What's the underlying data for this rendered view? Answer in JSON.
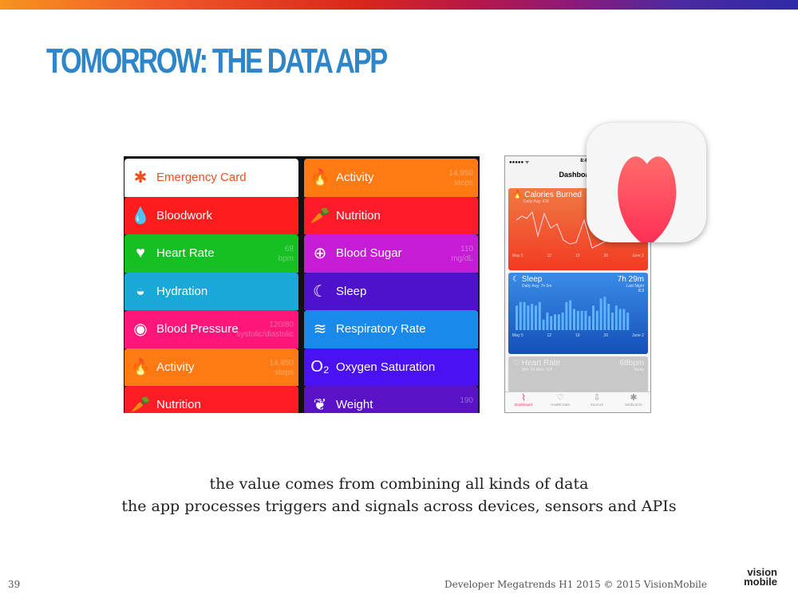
{
  "slide": {
    "title": "TOMORROW: THE DATA APP",
    "caption_line1": "the value comes from combining all kinds of data",
    "caption_line2": "the app processes triggers and signals across devices, sensors and APIs",
    "page_number": "39",
    "footer": "Developer Megatrends H1 2015 © 2015 VisionMobile",
    "logo_text_1": "vision",
    "logo_text_2": "mobile"
  },
  "left_list": [
    {
      "label": "Emergency Card",
      "icon": "asterisk-icon",
      "glyph": "✱",
      "color": "#ffffff",
      "text_color": "#f0501e"
    },
    {
      "label": "Bloodwork",
      "icon": "drop-icon",
      "glyph": "💧",
      "color": "#ff1c1c"
    },
    {
      "label": "Heart Rate",
      "icon": "heart-icon",
      "glyph": "♥",
      "color": "#16c022",
      "value": "68",
      "unit": "bpm"
    },
    {
      "label": "Hydration",
      "icon": "drop-icon",
      "glyph": "◒",
      "color": "#1aa8d6"
    },
    {
      "label": "Blood Pressure",
      "icon": "thermometer-drop-icon",
      "glyph": "◉",
      "color": "#ff167a",
      "value": "120/80",
      "unit": "systolic/diastolic"
    },
    {
      "label": "Activity",
      "icon": "flame-icon",
      "glyph": "🔥",
      "color": "#ff7a12",
      "value": "14,950",
      "unit": "steps"
    },
    {
      "label": "Nutrition",
      "icon": "carrot-icon",
      "glyph": "🥕",
      "color": "#ff1c24"
    }
  ],
  "right_list": [
    {
      "label": "Activity",
      "icon": "flame-icon",
      "glyph": "🔥",
      "color": "#ff7a12",
      "value": "14,950",
      "unit": "steps"
    },
    {
      "label": "Nutrition",
      "icon": "carrot-icon",
      "glyph": "🥕",
      "color": "#ff1c2a"
    },
    {
      "label": "Blood Sugar",
      "icon": "drop-plus-icon",
      "glyph": "⊕",
      "color": "#c61cd6",
      "value": "110",
      "unit": "mg/dL"
    },
    {
      "label": "Sleep",
      "icon": "moon-icon",
      "glyph": "☾",
      "color": "#4e12cc"
    },
    {
      "label": "Respiratory Rate",
      "icon": "wind-icon",
      "glyph": "≋",
      "color": "#1a8aea"
    },
    {
      "label": "Oxygen Saturation",
      "icon": "o2-icon",
      "glyph": "O₂",
      "color": "#4a12f0"
    },
    {
      "label": "Weight",
      "icon": "feather-icon",
      "glyph": "❦",
      "color": "#5a12c6",
      "value": "190"
    }
  ],
  "phone": {
    "status_signal": "●●●●● ᯤ",
    "status_time": "8:41 AM",
    "nav_title": "Dashboard",
    "calories": {
      "title": "Calories Burned",
      "subtitle": "Daily Avg: 425",
      "color": "#f2522c"
    },
    "sleep": {
      "title": "Sleep",
      "subtitle": "Daily Avg: 7h 6m",
      "value": "7h 29m",
      "value_sub": "Last Night",
      "ymax": "8.3",
      "ymin": "0",
      "color": "#1e6fdc"
    },
    "heart": {
      "title": "Heart Rate",
      "subtitle": "Min: 53 Max: 126",
      "value": "68bpm",
      "value_sub": "Today",
      "ymax": "126"
    },
    "x_ticks": [
      "May 5",
      "12",
      "19",
      "26",
      "June 2"
    ],
    "tabs": [
      {
        "label": "Dashboard",
        "active": true
      },
      {
        "label": "Health Data"
      },
      {
        "label": "Sources"
      },
      {
        "label": "Medical ID"
      }
    ]
  },
  "app_icon": {
    "name": "Health",
    "heart_color": "#ff2d55"
  }
}
